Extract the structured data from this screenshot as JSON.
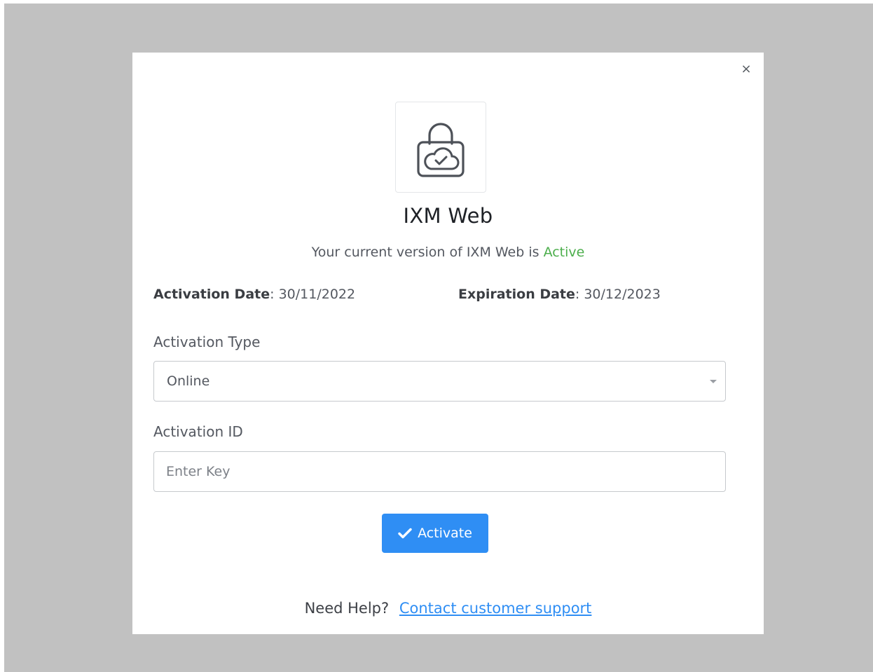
{
  "dialog": {
    "close_icon": "close-icon",
    "close_glyph": "×",
    "logo_icon": "lock-cloud-check-icon",
    "title": "IXM Web",
    "status_prefix": "Your current version of IXM Web is",
    "status_value": "Active",
    "status_color": "#4cae4c",
    "activation_date_label": "Activation Date",
    "activation_date_value": "30/11/2022",
    "expiration_date_label": "Expiration Date",
    "expiration_date_value": "30/12/2023",
    "activation_type_label": "Activation Type",
    "activation_type_value": "Online",
    "activation_id_label": "Activation ID",
    "activation_id_value": "",
    "activation_id_placeholder": "Enter Key",
    "activate_button_label": "Activate",
    "activate_button_color": "#2f8ef4",
    "help_text": "Need Help?",
    "help_link_text": "Contact customer support"
  }
}
